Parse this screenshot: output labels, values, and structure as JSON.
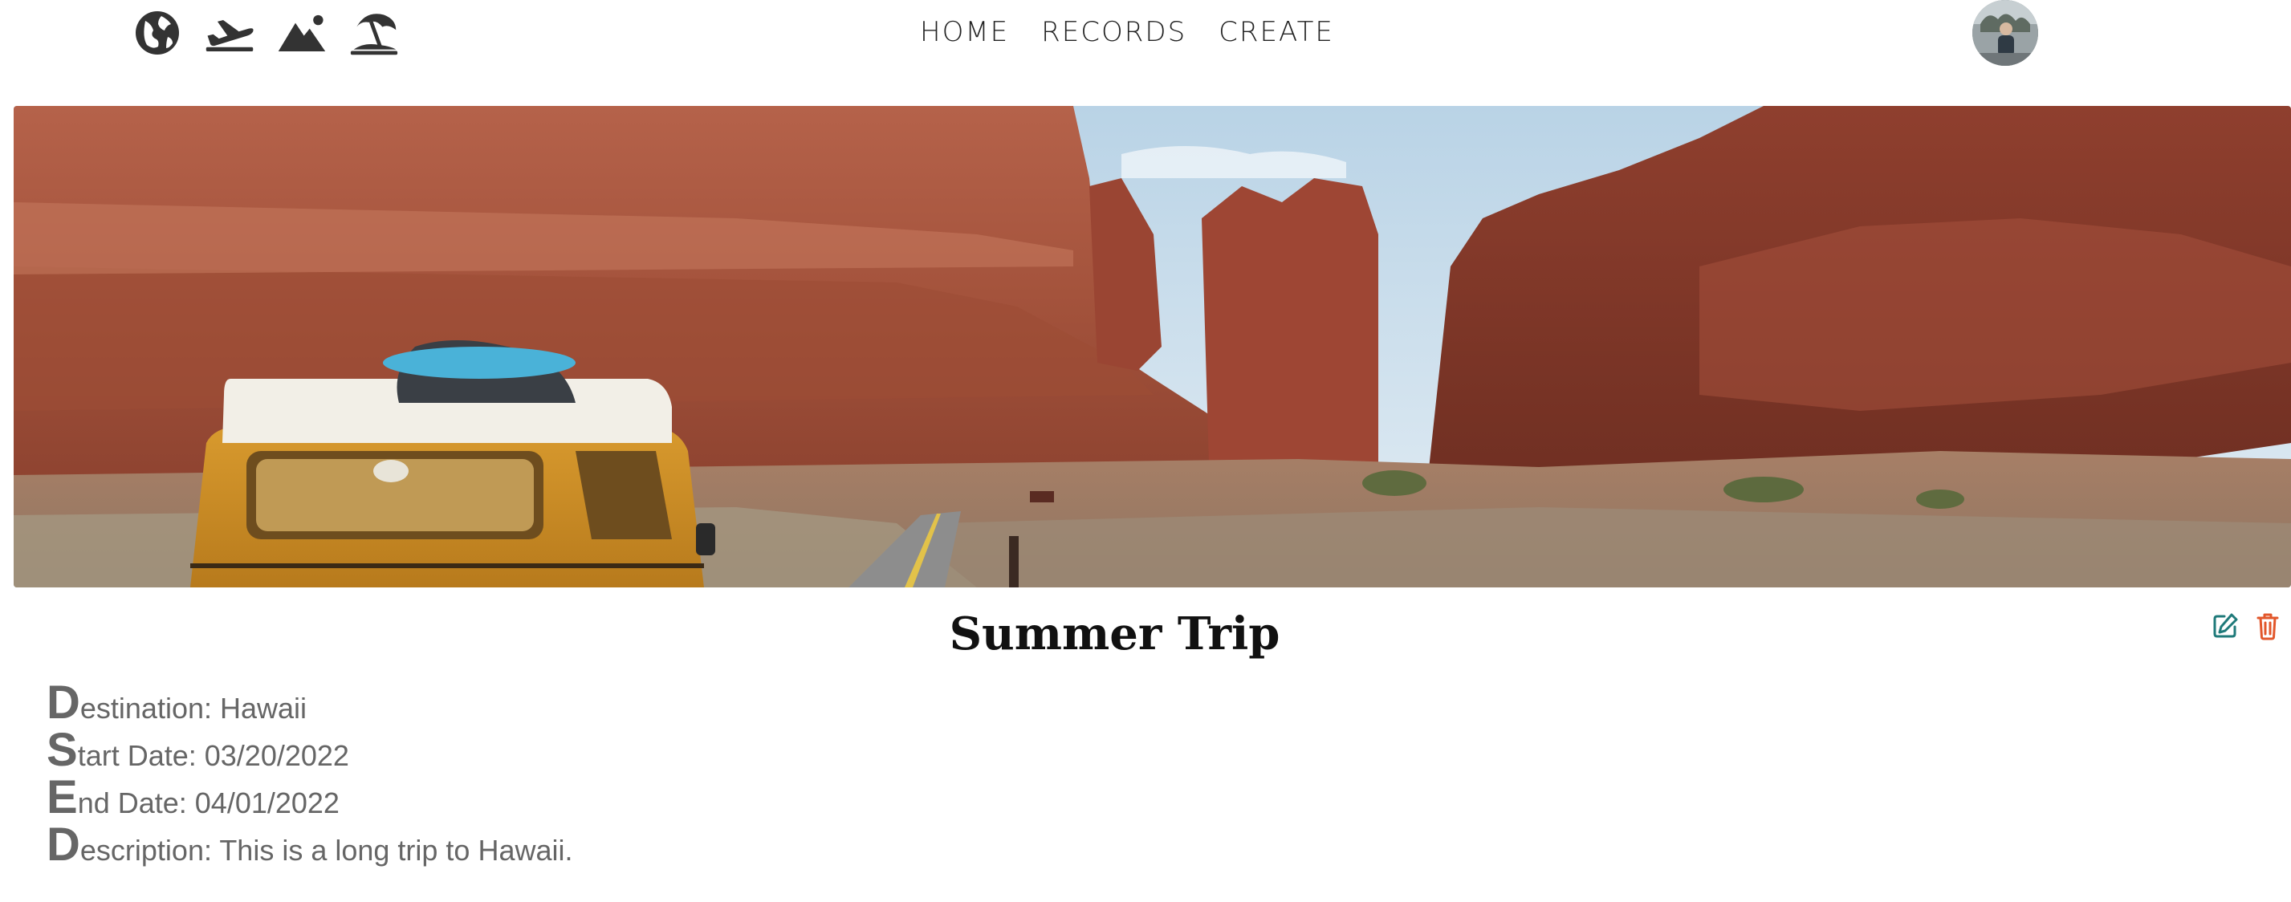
{
  "nav": {
    "icons": [
      {
        "name": "globe-icon"
      },
      {
        "name": "airplane-departure-icon"
      },
      {
        "name": "mountain-icon"
      },
      {
        "name": "beach-umbrella-icon"
      }
    ],
    "links": [
      "HOME",
      "RECORDS",
      "CREATE"
    ],
    "icon_color": "#333333"
  },
  "hero": {
    "image_subject": "yellow camper van driving on desert road between red rock canyon walls"
  },
  "trip": {
    "title": "Summer Trip",
    "destination": {
      "cap": "D",
      "rest": "estination: Hawaii"
    },
    "start_date": {
      "cap": "S",
      "rest": "tart Date: 03/20/2022"
    },
    "end_date": {
      "cap": "E",
      "rest": "nd Date: 04/01/2022"
    },
    "description": {
      "cap": "D",
      "rest": "escription: This is a long trip to Hawaii."
    }
  },
  "actions": {
    "edit_icon": "edit-icon",
    "edit_color": "#1f7a7a",
    "delete_icon": "trash-icon",
    "delete_color": "#e2572b"
  }
}
